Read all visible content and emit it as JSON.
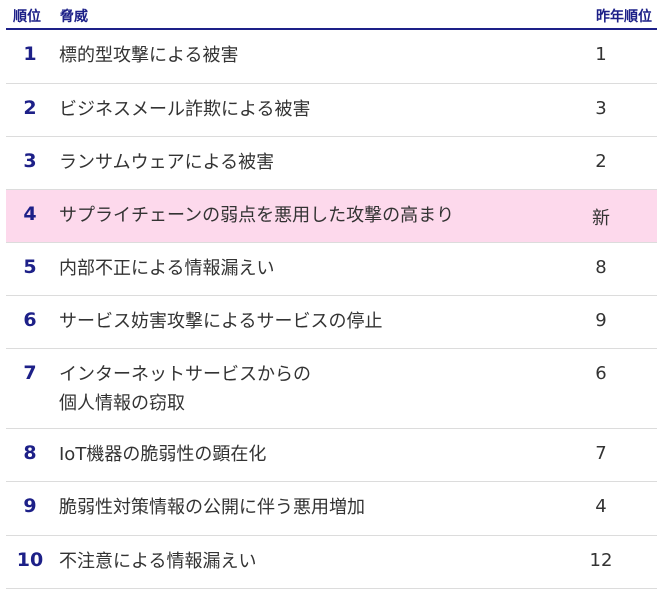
{
  "header": {
    "rank": "順位",
    "threat": "脅威",
    "previous_rank": "昨年順位"
  },
  "rows": [
    {
      "rank": "1",
      "threat_line1": "標的型攻撃による被害",
      "threat_line2": "",
      "previous_rank": "1",
      "highlighted": false
    },
    {
      "rank": "2",
      "threat_line1": "ビジネスメール詐欺による被害",
      "threat_line2": "",
      "previous_rank": "3",
      "highlighted": false
    },
    {
      "rank": "3",
      "threat_line1": "ランサムウェアによる被害",
      "threat_line2": "",
      "previous_rank": "2",
      "highlighted": false
    },
    {
      "rank": "4",
      "threat_line1": "サプライチェーンの弱点を悪用した攻撃の高まり",
      "threat_line2": "",
      "previous_rank": "新",
      "highlighted": true
    },
    {
      "rank": "5",
      "threat_line1": "内部不正による情報漏えい",
      "threat_line2": "",
      "previous_rank": "8",
      "highlighted": false
    },
    {
      "rank": "6",
      "threat_line1": "サービス妨害攻撃によるサービスの停止",
      "threat_line2": "",
      "previous_rank": "9",
      "highlighted": false
    },
    {
      "rank": "7",
      "threat_line1": "インターネットサービスからの",
      "threat_line2": "個人情報の窃取",
      "previous_rank": "6",
      "highlighted": false
    },
    {
      "rank": "8",
      "threat_line1": "IoT機器の脆弱性の顕在化",
      "threat_line2": "",
      "previous_rank": "7",
      "highlighted": false
    },
    {
      "rank": "9",
      "threat_line1": "脆弱性対策情報の公開に伴う悪用増加",
      "threat_line2": "",
      "previous_rank": "4",
      "highlighted": false
    },
    {
      "rank": "10",
      "threat_line1": "不注意による情報漏えい",
      "threat_line2": "",
      "previous_rank": "12",
      "highlighted": false
    }
  ],
  "colors": {
    "accent": "#1d2088",
    "highlight_row": "#fdd9ec",
    "divider": "#dcdcdc",
    "text": "#333333"
  }
}
